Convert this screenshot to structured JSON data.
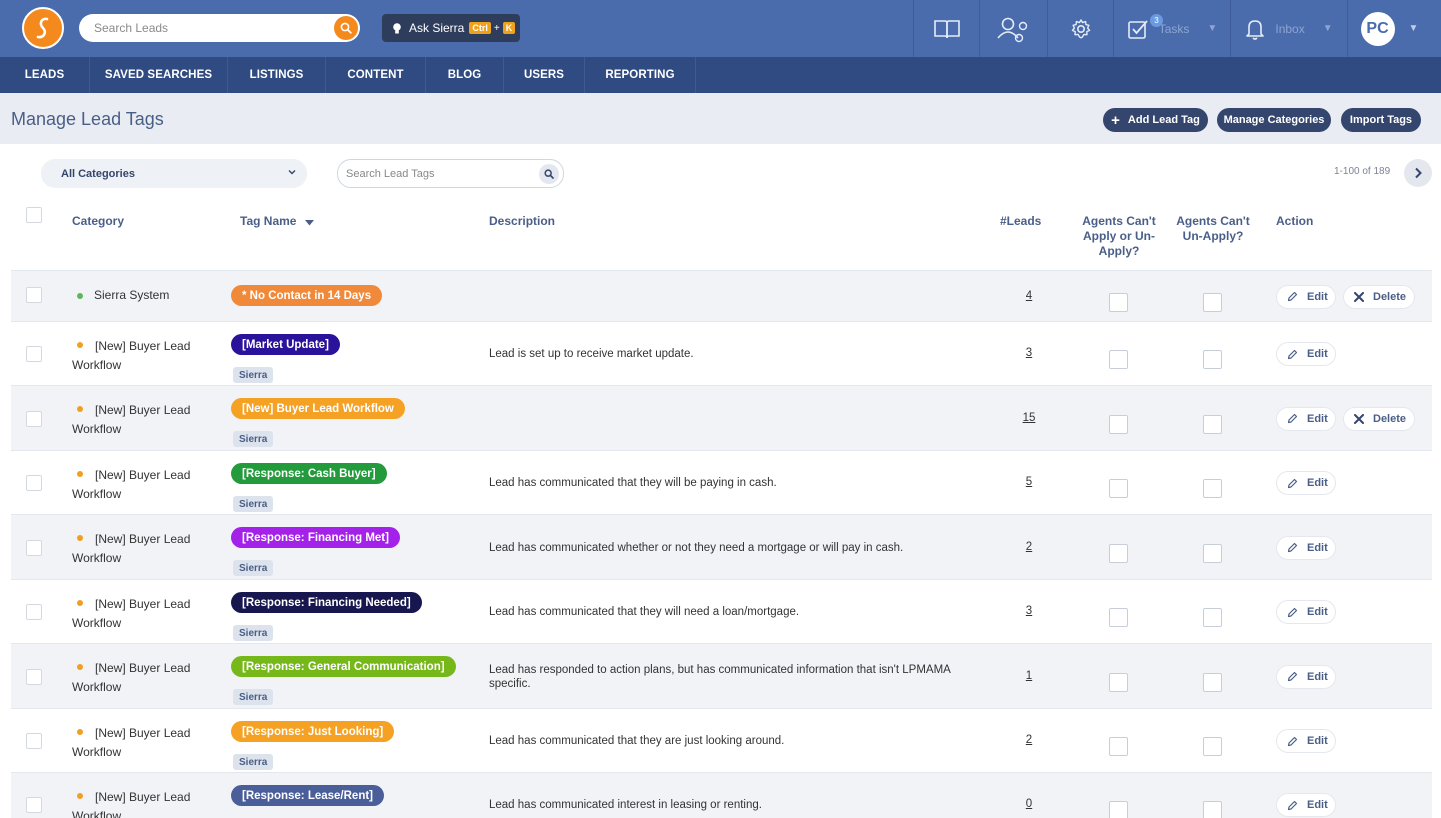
{
  "topbar": {
    "search_placeholder": "Search Leads",
    "ask_label": "Ask Sierra",
    "ask_shortcut_1": "Ctrl",
    "ask_shortcut_plus": "+",
    "ask_shortcut_2": "K",
    "tasks_label": "Tasks",
    "tasks_count": "3",
    "inbox_label": "Inbox",
    "avatar_initials": "PC",
    "icons": [
      "book-icon",
      "users-icon",
      "gear-icon",
      "tasks-icon",
      "bell-icon"
    ]
  },
  "nav": {
    "items": [
      "LEADS",
      "SAVED SEARCHES",
      "LISTINGS",
      "CONTENT",
      "BLOG",
      "USERS",
      "REPORTING"
    ]
  },
  "page": {
    "title": "Manage Lead Tags",
    "add_button": "Add Lead Tag",
    "manage_categories_button": "Manage Categories",
    "import_button": "Import Tags"
  },
  "filters": {
    "category_selected": "All Categories",
    "search_placeholder": "Search Lead Tags",
    "pagination": "1-100 of 189"
  },
  "table": {
    "headers": {
      "category": "Category",
      "tag_name": "Tag Name",
      "description": "Description",
      "leads": "#Leads",
      "agents_cant_apply": "Agents Can't Apply or Un-Apply?",
      "agents_cant_unapply": "Agents Can't Un-Apply?",
      "action": "Action"
    },
    "edit_label": "Edit",
    "delete_label": "Delete",
    "rows": [
      {
        "category": "Sierra System",
        "tag": "* No Contact in 14 Days",
        "tag_color": "#f08a3a",
        "source": "",
        "description": "",
        "leads": "4",
        "dot": "#5cb85c",
        "deletable": true
      },
      {
        "category": "[New] Buyer Lead Workflow",
        "tag": "[Market Update]",
        "tag_color": "#2a129a",
        "source": "Sierra",
        "description": "Lead is set up to receive market update.",
        "leads": "3",
        "dot": "#f0a020",
        "deletable": false
      },
      {
        "category": "[New] Buyer Lead Workflow",
        "tag": "[New] Buyer Lead Workflow",
        "tag_color": "#f4a124",
        "source": "Sierra",
        "description": "",
        "leads": "15",
        "dot": "#f0a020",
        "deletable": true
      },
      {
        "category": "[New] Buyer Lead Workflow",
        "tag": "[Response: Cash Buyer]",
        "tag_color": "#239a3b",
        "source": "Sierra",
        "description": "Lead has communicated that they will be paying in cash.",
        "leads": "5",
        "dot": "#f0a020",
        "deletable": false
      },
      {
        "category": "[New] Buyer Lead Workflow",
        "tag": "[Response: Financing Met]",
        "tag_color": "#a321e8",
        "source": "Sierra",
        "description": "Lead has communicated whether or not they need a mortgage or will pay in cash.",
        "leads": "2",
        "dot": "#f0a020",
        "deletable": false
      },
      {
        "category": "[New] Buyer Lead Workflow",
        "tag": "[Response: Financing Needed]",
        "tag_color": "#17164f",
        "source": "Sierra",
        "description": "Lead has communicated that they will need a loan/mortgage.",
        "leads": "3",
        "dot": "#f0a020",
        "deletable": false
      },
      {
        "category": "[New] Buyer Lead Workflow",
        "tag": "[Response: General Communication]",
        "tag_color": "#76b81a",
        "source": "Sierra",
        "description": "Lead has responded to action plans, but has communicated information that isn't LPMAMA specific.",
        "leads": "1",
        "dot": "#f0a020",
        "deletable": false
      },
      {
        "category": "[New] Buyer Lead Workflow",
        "tag": "[Response: Just Looking]",
        "tag_color": "#f4a124",
        "source": "Sierra",
        "description": "Lead has communicated that they are just looking around.",
        "leads": "2",
        "dot": "#f0a020",
        "deletable": false
      },
      {
        "category": "[New] Buyer Lead Workflow",
        "tag": "[Response: Lease/Rent]",
        "tag_color": "#4a5f99",
        "source": "",
        "description": "Lead has communicated interest in leasing or renting.",
        "leads": "0",
        "dot": "#f0a020",
        "deletable": false
      }
    ]
  }
}
